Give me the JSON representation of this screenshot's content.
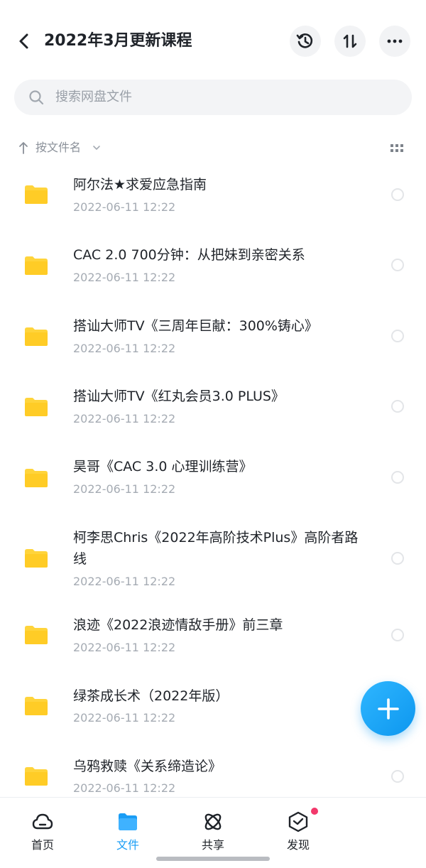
{
  "header": {
    "title": "2022年3月更新课程",
    "back_icon": "chevron-left-icon",
    "actions": [
      "history-icon",
      "sort-swap-icon",
      "more-icon"
    ]
  },
  "search": {
    "placeholder": "搜索网盘文件",
    "icon": "search-icon"
  },
  "sort_bar": {
    "label": "按文件名",
    "view_icon": "grid-view-icon"
  },
  "files": [
    {
      "name": "阿尔法★求爱应急指南",
      "date": "2022-06-11  12:22"
    },
    {
      "name": "CAC 2.0 700分钟：从把妹到亲密关系",
      "date": "2022-06-11  12:22"
    },
    {
      "name": "搭讪大师TV《三周年巨献：300%铸心》",
      "date": "2022-06-11  12:22"
    },
    {
      "name": "搭讪大师TV《红丸会员3.0 PLUS》",
      "date": "2022-06-11  12:22"
    },
    {
      "name": "昊哥《CAC 3.0 心理训练营》",
      "date": "2022-06-11  12:22"
    },
    {
      "name": "柯李思Chris《2022年高阶技术Plus》高阶者路线",
      "date": "2022-06-11  12:22"
    },
    {
      "name": "浪迹《2022浪迹情敌手册》前三章",
      "date": "2022-06-11  12:22"
    },
    {
      "name": "绿茶成长术（2022年版）",
      "date": "2022-06-11  12:22"
    },
    {
      "name": "乌鸦救赎《关系缔造论》",
      "date": "2022-06-11  12:22"
    }
  ],
  "fab": {
    "icon": "plus-icon"
  },
  "bottom_nav": [
    {
      "label": "首页",
      "icon": "cloud-icon",
      "active": false
    },
    {
      "label": "文件",
      "icon": "folder-icon",
      "active": true
    },
    {
      "label": "共享",
      "icon": "atom-icon",
      "active": false
    },
    {
      "label": "发现",
      "icon": "cube-icon",
      "active": false,
      "badge": true
    }
  ],
  "colors": {
    "accent": "#1a9df5",
    "folder": "#ffd43b",
    "badge": "#f2386b"
  }
}
